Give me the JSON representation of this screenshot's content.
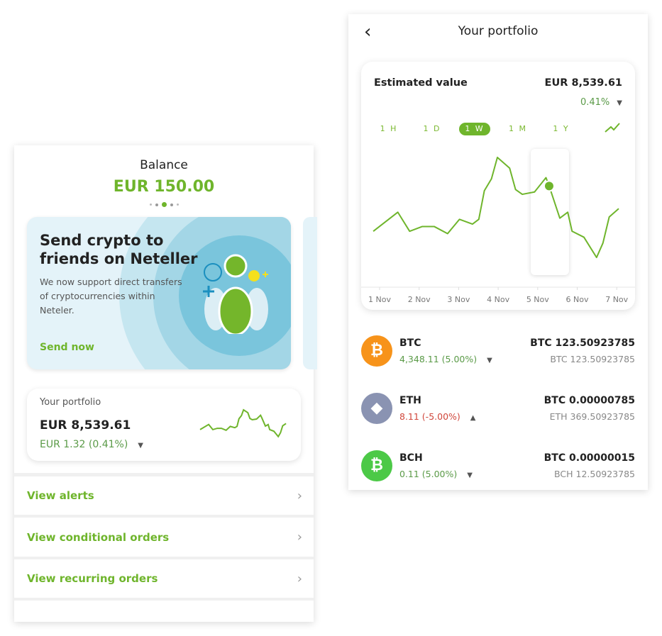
{
  "colors": {
    "accent": "#6fb52c",
    "positive": "#5a9a47",
    "negative": "#d0463b"
  },
  "left": {
    "balance_label": "Balance",
    "balance_value": "EUR 150.00",
    "carousel_dots": 5,
    "carousel_active": 2,
    "promo": {
      "title_line1": "Send crypto to",
      "title_line2": "friends on Neteller",
      "body": "We now support direct transfers of cryptocurrencies within Neteler.",
      "cta": "Send now"
    },
    "portfolio": {
      "label": "Your portfolio",
      "value": "EUR 8,539.61",
      "change": "EUR 1.32 (0.41%)"
    },
    "menu": [
      {
        "label": "View alerts"
      },
      {
        "label": "View conditional orders"
      },
      {
        "label": "View recurring orders"
      }
    ]
  },
  "right": {
    "title": "Your portfolio",
    "estimated_label": "Estimated value",
    "estimated_value": "EUR 8,539.61",
    "estimated_change": "0.41%",
    "timeframes": [
      "1 H",
      "1 D",
      "1 W",
      "1 M",
      "1 Y"
    ],
    "active_timeframe": "1 W",
    "assets": [
      {
        "symbol": "BTC",
        "change": "4,348.11 (5.00%)",
        "direction": "down",
        "trend": "positive",
        "value": "BTC 123.50923785",
        "sub": "BTC 123.50923785",
        "icon": "bitcoin-icon",
        "color": "#f7931a",
        "glyph": "₿"
      },
      {
        "symbol": "ETH",
        "change": "8.11 (-5.00%)",
        "direction": "up",
        "trend": "negative",
        "value": "BTC 0.00000785",
        "sub": "ETH 369.50923785",
        "icon": "ethereum-icon",
        "color": "#8a93b2",
        "glyph": "◆"
      },
      {
        "symbol": "BCH",
        "change": "0.11 (5.00%)",
        "direction": "down",
        "trend": "positive",
        "value": "BTC 0.00000015",
        "sub": "BCH 12.50923785",
        "icon": "bitcoin-cash-icon",
        "color": "#4cc947",
        "glyph": "₿"
      }
    ]
  },
  "chart_data": {
    "type": "line",
    "title": "",
    "xlabel": "",
    "ylabel": "",
    "x_ticks": [
      "1 Nov",
      "2 Nov",
      "3 Nov",
      "4 Nov",
      "5 Nov",
      "6 Nov",
      "7 Nov"
    ],
    "x": [
      0.84,
      1.46,
      1.76,
      2.08,
      2.38,
      2.72,
      3.02,
      3.35,
      3.51,
      3.65,
      3.83,
      3.98,
      4.29,
      4.44,
      4.61,
      4.92,
      5.21,
      5.29,
      5.56,
      5.76,
      5.87,
      6.17,
      6.49,
      6.65,
      6.81,
      7.05
    ],
    "y": [
      38,
      54,
      38,
      42,
      42,
      36,
      48,
      44,
      48,
      72,
      82,
      100,
      91,
      73,
      69,
      71,
      83,
      76,
      49,
      54,
      38,
      33,
      16,
      28,
      50,
      57
    ],
    "selected_index": 17,
    "grid": false,
    "legend": "none"
  }
}
